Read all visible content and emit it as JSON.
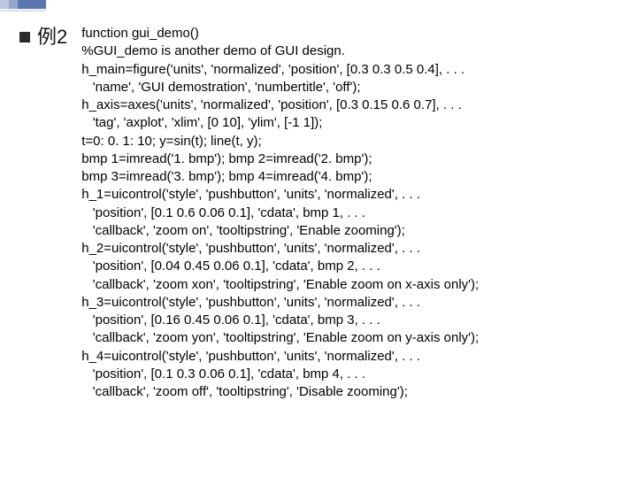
{
  "heading": "例2",
  "code_lines": [
    "function gui_demo()",
    "%GUI_demo is another demo of GUI design.",
    "h_main=figure('units', 'normalized', 'position', [0.3 0.3 0.5 0.4], . . .",
    "   'name', 'GUI demostration', 'numbertitle', 'off');",
    "h_axis=axes('units', 'normalized', 'position', [0.3 0.15 0.6 0.7], . . .",
    "   'tag', 'axplot', 'xlim', [0 10], 'ylim', [-1 1]);",
    "t=0: 0. 1: 10; y=sin(t); line(t, y);",
    "bmp 1=imread('1. bmp'); bmp 2=imread('2. bmp');",
    "bmp 3=imread('3. bmp'); bmp 4=imread('4. bmp');",
    "h_1=uicontrol('style', 'pushbutton', 'units', 'normalized', . . .",
    "   'position', [0.1 0.6 0.06 0.1], 'cdata', bmp 1, . . .",
    "   'callback', 'zoom on', 'tooltipstring', 'Enable zooming');",
    "h_2=uicontrol('style', 'pushbutton', 'units', 'normalized', . . .",
    "   'position', [0.04 0.45 0.06 0.1], 'cdata', bmp 2, . . .",
    "   'callback', 'zoom xon', 'tooltipstring', 'Enable zoom on x-axis only');",
    "h_3=uicontrol('style', 'pushbutton', 'units', 'normalized', . . .",
    "   'position', [0.16 0.45 0.06 0.1], 'cdata', bmp 3, . . .",
    "   'callback', 'zoom yon', 'tooltipstring', 'Enable zoom on y-axis only');",
    "h_4=uicontrol('style', 'pushbutton', 'units', 'normalized', . . .",
    "   'position', [0.1 0.3 0.06 0.1], 'cdata', bmp 4, . . .",
    "   'callback', 'zoom off', 'tooltipstring', 'Disable zooming');"
  ]
}
